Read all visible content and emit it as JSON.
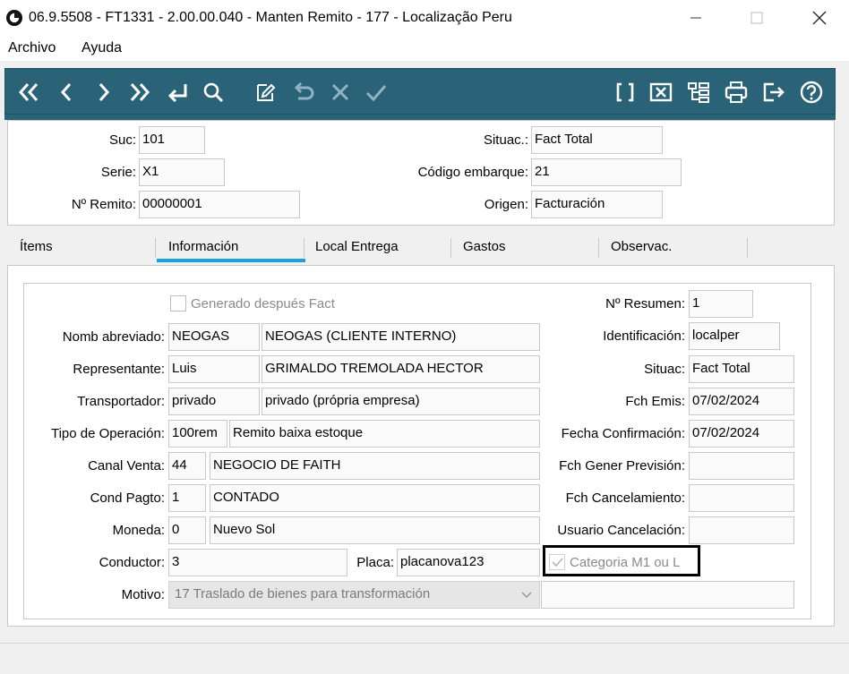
{
  "window": {
    "title": "06.9.5508 - FT1331 - 2.00.00.040 - Manten Remito - 177 - Localização Peru",
    "icons": [
      "app-icon",
      "minimize-icon",
      "maximize-icon",
      "close-icon"
    ]
  },
  "menu": {
    "items": [
      "Archivo",
      "Ayuda"
    ]
  },
  "toolbar": {
    "color": "#2a6278",
    "left_icons": [
      "first-icon",
      "previous-icon",
      "next-icon",
      "last-icon",
      "goto-icon",
      "search-icon",
      "edit-icon",
      "undo-icon",
      "cancel-icon",
      "confirm-icon"
    ],
    "right_icons": [
      "brackets-icon",
      "delete-icon",
      "tree-icon",
      "print-icon",
      "exit-icon",
      "help-icon"
    ]
  },
  "header": {
    "suc": {
      "label": "Suc:",
      "value": "101"
    },
    "serie": {
      "label": "Serie:",
      "value": "X1"
    },
    "remito": {
      "label": "Nº Remito:",
      "value": "00000001"
    },
    "situac": {
      "label": "Situac.:",
      "value": "Fact Total"
    },
    "codigo_embarque": {
      "label": "Código embarque:",
      "value": "21"
    },
    "origen": {
      "label": "Origen:",
      "value": "Facturación"
    }
  },
  "tabs": {
    "items": [
      "Ítems",
      "Información",
      "Local Entrega",
      "Gastos",
      "Observac."
    ],
    "active": "Información",
    "accent": "#1ba1e2"
  },
  "info": {
    "generado": {
      "label": "Generado después Fact",
      "checked": false
    },
    "nombre": {
      "label": "Nomb abreviado:",
      "code": "NEOGAS",
      "desc": "NEOGAS (CLIENTE INTERNO)"
    },
    "representante": {
      "label": "Representante:",
      "code": "Luis",
      "desc": "GRIMALDO TREMOLADA HECTOR"
    },
    "transportador": {
      "label": "Transportador:",
      "code": "privado",
      "desc": "privado (própria empresa)"
    },
    "tipo_operacion": {
      "label": "Tipo de Operación:",
      "code": "100rem",
      "desc": "Remito baixa estoque"
    },
    "canal_venta": {
      "label": "Canal Venta:",
      "code": "44",
      "desc": "NEGOCIO DE FAITH"
    },
    "cond_pagto": {
      "label": "Cond Pagto:",
      "code": "1",
      "desc": "CONTADO"
    },
    "moneda": {
      "label": "Moneda:",
      "code": "0",
      "desc": "Nuevo Sol"
    },
    "conductor": {
      "label": "Conductor:",
      "value": "3"
    },
    "placa": {
      "label": "Placa:",
      "value": "placanova123"
    },
    "motivo": {
      "label": "Motivo:",
      "value": "17 Traslado de bienes para transformación"
    },
    "resumen": {
      "label": "Nº Resumen:",
      "value": "1"
    },
    "identificacion": {
      "label": "Identificación:",
      "value": "localper"
    },
    "situac": {
      "label": "Situac:",
      "value": "Fact Total"
    },
    "fch_emis": {
      "label": "Fch Emis:",
      "value": "07/02/2024"
    },
    "fecha_confirmacion": {
      "label": "Fecha Confirmación:",
      "value": "07/02/2024"
    },
    "fch_gener_prevision": {
      "label": "Fch Gener Previsión:",
      "value": ""
    },
    "fch_cancelamiento": {
      "label": "Fch Cancelamiento:",
      "value": ""
    },
    "usuario_cancelacion": {
      "label": "Usuario Cancelación:",
      "value": ""
    },
    "categoria": {
      "label": "Categoria M1 ou L",
      "checked": true
    },
    "extra_field": {
      "value": ""
    }
  }
}
